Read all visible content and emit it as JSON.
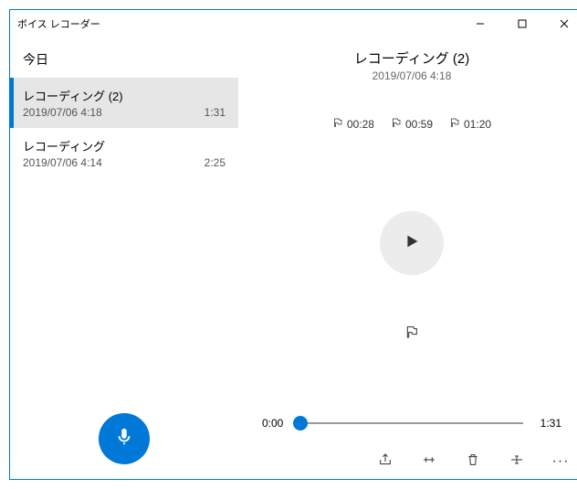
{
  "window": {
    "title": "ボイス レコーダー"
  },
  "sidebar": {
    "section": "今日",
    "items": [
      {
        "title": "レコーディング (2)",
        "datetime": "2019/07/06 4:18",
        "duration": "1:31",
        "selected": true
      },
      {
        "title": "レコーディング",
        "datetime": "2019/07/06 4:14",
        "duration": "2:25",
        "selected": false
      }
    ]
  },
  "main": {
    "title": "レコーディング (2)",
    "datetime": "2019/07/06 4:18",
    "markers": [
      "00:28",
      "00:59",
      "01:20"
    ],
    "timeline": {
      "current": "0:00",
      "total": "1:31"
    }
  },
  "icons": {
    "mic": "microphone-icon",
    "play": "play-icon",
    "flag": "flag-icon",
    "share": "share-icon",
    "trim": "trim-icon",
    "delete": "delete-icon",
    "rename": "rename-icon",
    "more": "more-icon"
  },
  "colors": {
    "accent": "#0078d7"
  }
}
